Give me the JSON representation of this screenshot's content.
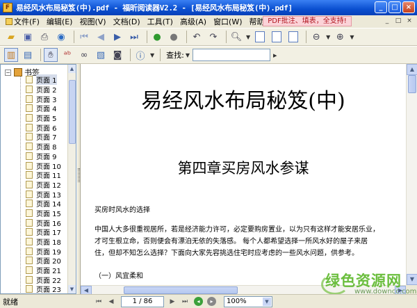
{
  "window": {
    "title": "易经风水布局秘笈(中).pdf - 福昕阅读器V2.2 - [易经风水布局秘笈(中).pdf]",
    "controls": [
      "_",
      "□",
      "×"
    ]
  },
  "menu": {
    "items": [
      "文件(F)",
      "编辑(E)",
      "视图(V)",
      "文档(D)",
      "工具(T)",
      "高级(A)",
      "窗口(W)",
      "帮助(H)"
    ],
    "promo": "PDF批注、填表，全支持!",
    "mdi_controls": [
      "_",
      "□",
      "×"
    ]
  },
  "toolbar2": {
    "find_label": "查找:",
    "find_value": ""
  },
  "sidebar": {
    "root_label": "书签",
    "items": [
      "页面 1",
      "页面 2",
      "页面 3",
      "页面 4",
      "页面 5",
      "页面 6",
      "页面 7",
      "页面 8",
      "页面 9",
      "页面 10",
      "页面 11",
      "页面 12",
      "页面 13",
      "页面 14",
      "页面 15",
      "页面 16",
      "页面 17",
      "页面 18",
      "页面 19",
      "页面 20",
      "页面 21",
      "页面 22",
      "页面 23"
    ],
    "selected_index": 0
  },
  "document": {
    "title": "易经风水布局秘笈(中)",
    "chapter": "第四章买房风水参谋",
    "section": "买房时风水的选择",
    "paragraph_lines": [
      "中国人大多很重视居所，若是经济能力许可，必定要购房置业，以为只有这样才能安居乐业，",
      "才可生根立命，否则便会有漂泊无依的失落感。  每个人都希望选择一所风水好的屋子来居",
      "住，但却不知怎么选择？下面向大家先容挑选住宅时应考虑的一些风水问题，供参考。"
    ],
    "subheading": "（一）风宜柔和"
  },
  "status": {
    "text": "就绪",
    "page_display": "1 / 86",
    "zoom": "100%"
  },
  "watermark": {
    "text": "绿色资源网",
    "url": "www.downcc.com"
  }
}
